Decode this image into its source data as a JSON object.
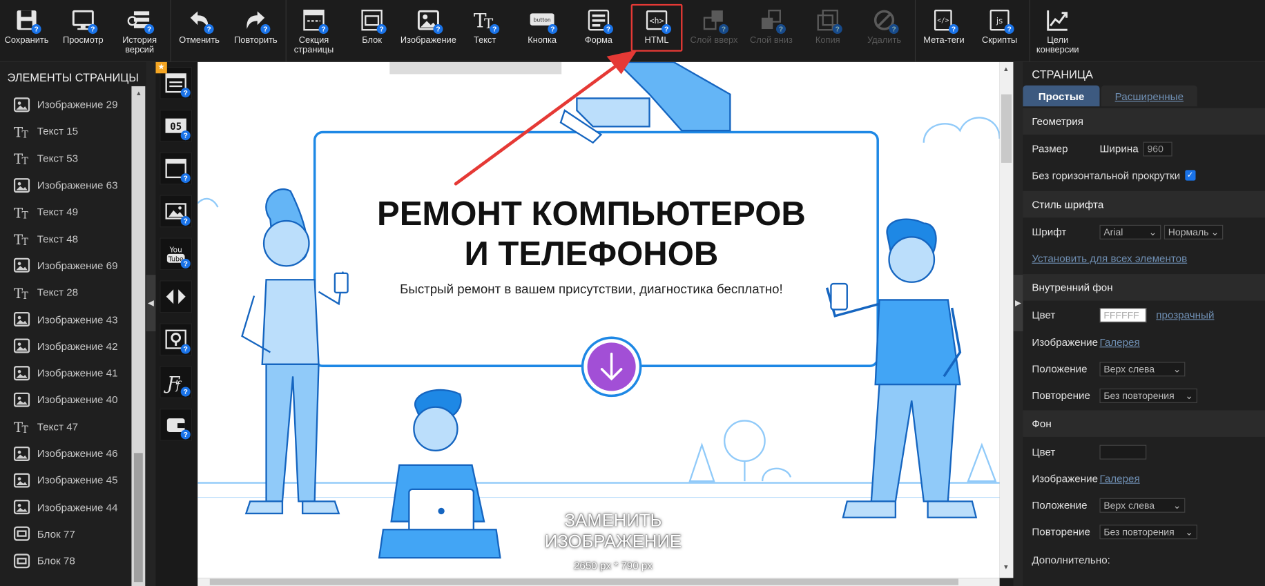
{
  "toolbar": {
    "items": [
      {
        "label": "Сохранить"
      },
      {
        "label": "Просмотр"
      },
      {
        "label": "История версий"
      },
      {
        "label": "Отменить"
      },
      {
        "label": "Повторить"
      },
      {
        "label": "Секция страницы"
      },
      {
        "label": "Блок"
      },
      {
        "label": "Изображение"
      },
      {
        "label": "Текст"
      },
      {
        "label": "Кнопка"
      },
      {
        "label": "Форма"
      },
      {
        "label": "HTML"
      },
      {
        "label": "Слой вверх"
      },
      {
        "label": "Слой вниз"
      },
      {
        "label": "Копия"
      },
      {
        "label": "Удалить"
      },
      {
        "label": "Мета-теги"
      },
      {
        "label": "Скрипты"
      },
      {
        "label": "Цели конверсии"
      }
    ],
    "help_badge": "?",
    "button_icon_text": "button"
  },
  "left_panel": {
    "title": "ЭЛЕМЕНТЫ СТРАНИЦЫ",
    "items": [
      {
        "label": "Изображение 29",
        "icon": "image-icon"
      },
      {
        "label": "Текст 15",
        "icon": "text-icon"
      },
      {
        "label": "Текст 53",
        "icon": "text-icon"
      },
      {
        "label": "Изображение 63",
        "icon": "image-icon"
      },
      {
        "label": "Текст 49",
        "icon": "text-icon"
      },
      {
        "label": "Текст 48",
        "icon": "text-icon"
      },
      {
        "label": "Изображение 69",
        "icon": "image-icon"
      },
      {
        "label": "Текст 28",
        "icon": "text-icon"
      },
      {
        "label": "Изображение 43",
        "icon": "image-icon"
      },
      {
        "label": "Изображение 42",
        "icon": "image-icon"
      },
      {
        "label": "Изображение 41",
        "icon": "image-icon"
      },
      {
        "label": "Изображение 40",
        "icon": "image-icon"
      },
      {
        "label": "Текст 47",
        "icon": "text-icon"
      },
      {
        "label": "Изображение 46",
        "icon": "image-icon"
      },
      {
        "label": "Изображение 45",
        "icon": "image-icon"
      },
      {
        "label": "Изображение 44",
        "icon": "image-icon"
      },
      {
        "label": "Блок 77",
        "icon": "block-icon"
      },
      {
        "label": "Блок 78",
        "icon": "block-icon"
      }
    ]
  },
  "widgets": {
    "counter_text": "05",
    "youtube_text": "You Tube",
    "items": [
      "form-widget-icon",
      "timer-widget-icon",
      "popup-widget-icon",
      "gallery-widget-icon",
      "youtube-widget-icon",
      "slider-widget-icon",
      "map-widget-icon",
      "font-widget-icon",
      "wallet-widget-icon"
    ]
  },
  "canvas": {
    "title_line1": "РЕМОНТ КОМПЬЮТЕРОВ",
    "title_line2": "И ТЕЛЕФОНОВ",
    "subtitle": "Быстрый ремонт в вашем присутствии, диагностика бесплатно!",
    "replace_line1": "ЗАМЕНИТЬ",
    "replace_line2": "ИЗОБРАЖЕНИЕ",
    "image_size": "2650 px * 790 px"
  },
  "right_panel": {
    "title": "СТРАНИЦА",
    "tab_simple": "Простые",
    "tab_advanced": "Расширенные",
    "geometry": {
      "header": "Геометрия",
      "size_label": "Размер",
      "width_label": "Ширина",
      "width_value": "960",
      "no_hscroll_label": "Без горизонтальной прокрутки",
      "no_hscroll_checked": true
    },
    "font_style": {
      "header": "Стиль шрифта",
      "font_label": "Шрифт",
      "font_value": "Arial",
      "weight_value": "Нормаль",
      "apply_all": "Установить для всех элементов"
    },
    "inner_bg": {
      "header": "Внутренний фон",
      "color_label": "Цвет",
      "color_placeholder": "FFFFFF",
      "transparent_link": "прозрачный",
      "image_label": "Изображение",
      "gallery_link": "Галерея",
      "position_label": "Положение",
      "position_value": "Верх слева",
      "repeat_label": "Повторение",
      "repeat_value": "Без повторения"
    },
    "bg": {
      "header": "Фон",
      "color_label": "Цвет",
      "image_label": "Изображение",
      "gallery_link": "Галерея",
      "position_label": "Положение",
      "position_value": "Верх слева",
      "repeat_label": "Повторение",
      "repeat_value": "Без повторения"
    },
    "extra_header": "Дополнительно:"
  },
  "colors": {
    "accent": "#1a73e8",
    "highlight": "#e53935",
    "illustration_blue": "#1e88e5",
    "button_purple": "#a24fd6"
  }
}
